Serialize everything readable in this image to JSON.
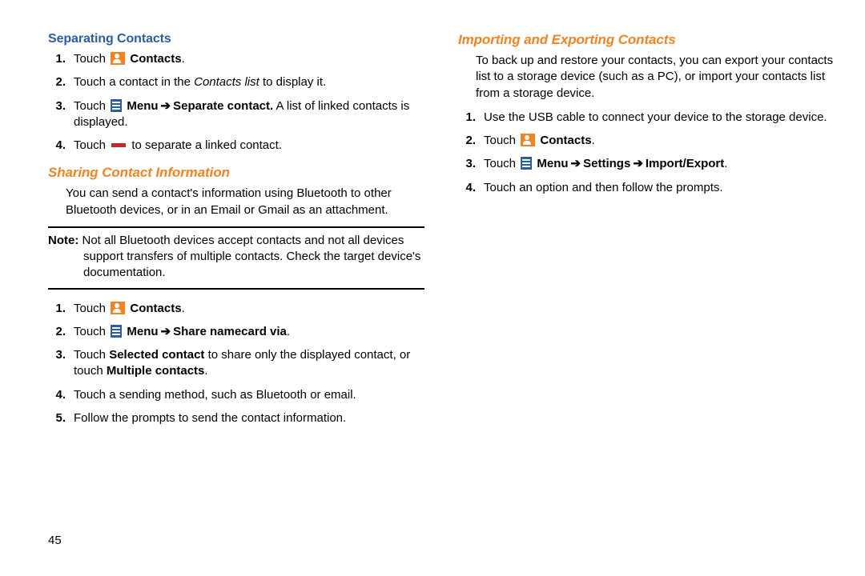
{
  "page_number": "45",
  "left": {
    "h1": "Separating Contacts",
    "step1_a": "Touch ",
    "step1_b": "Contacts",
    "step1_c": ".",
    "step2_a": "Touch a contact in the ",
    "step2_b": "Contacts list",
    "step2_c": " to display it.",
    "step3_a": "Touch ",
    "step3_b": "Menu",
    "step3_arrow": "➔",
    "step3_c": "Separate contact.",
    "step3_d": " A list of linked contacts is displayed.",
    "step4_a": "Touch ",
    "step4_b": " to separate a linked contact.",
    "h2": "Sharing Contact Information",
    "intro": "You can send a contact's information using Bluetooth to other Bluetooth devices, or in an Email or Gmail as an attachment.",
    "note_label": "Note:",
    "note_body": " Not all Bluetooth devices accept contacts and not all devices support transfers of multiple contacts. Check the target device's documentation.",
    "s2step1_a": "Touch ",
    "s2step1_b": "Contacts",
    "s2step1_c": ".",
    "s2step2_a": "Touch ",
    "s2step2_b": "Menu",
    "s2step2_arrow": "➔",
    "s2step2_c": "Share namecard via",
    "s2step2_d": ".",
    "s2step3_a": "Touch ",
    "s2step3_b": "Selected contact",
    "s2step3_c": " to share only the displayed contact, or touch ",
    "s2step3_d": "Multiple contacts",
    "s2step3_e": ".",
    "s2step4": "Touch a sending method, such as Bluetooth or email.",
    "s2step5": "Follow the prompts to send the contact information."
  },
  "right": {
    "h1": "Importing and Exporting Contacts",
    "intro": "To back up and restore your contacts, you can export your contacts list to a storage device (such as a PC), or import your contacts list from a storage device.",
    "step1": "Use the USB cable to connect your device to the storage device.",
    "step2_a": "Touch ",
    "step2_b": "Contacts",
    "step2_c": ".",
    "step3_a": "Touch ",
    "step3_b": "Menu",
    "step3_arrow1": "➔",
    "step3_c": "Settings",
    "step3_arrow2": "➔",
    "step3_d": "Import/Export",
    "step3_e": ".",
    "step4": "Touch an option and then follow the prompts."
  }
}
